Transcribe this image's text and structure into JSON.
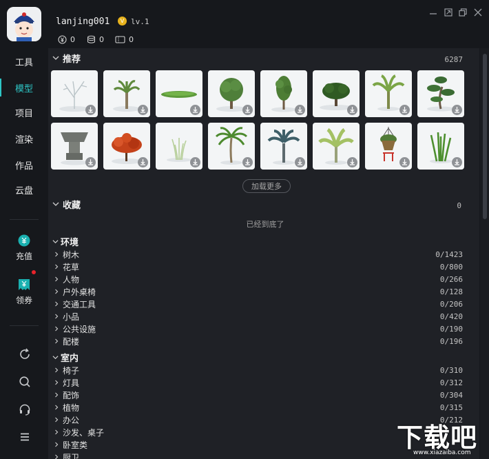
{
  "user": {
    "name": "lanjing001",
    "level": "lv.1",
    "level_badge": "V"
  },
  "stats": [
    {
      "icon": "yen-coin-icon",
      "value": "0"
    },
    {
      "icon": "coin-stack-icon",
      "value": "0"
    },
    {
      "icon": "ticket-icon",
      "value": "0"
    }
  ],
  "window_controls": [
    "minimize-icon",
    "restore-icon",
    "maximize-icon",
    "close-icon"
  ],
  "sidebar": {
    "items": [
      {
        "label": "工具"
      },
      {
        "label": "模型",
        "active": true
      },
      {
        "label": "项目"
      },
      {
        "label": "渲染"
      },
      {
        "label": "作品"
      },
      {
        "label": "云盘"
      }
    ],
    "recharge": {
      "label": "充值",
      "icon": "yen-bubble-icon"
    },
    "coupon": {
      "label": "领券",
      "icon": "coupon-icon"
    },
    "tools": [
      "refresh-icon",
      "search-icon",
      "headset-icon",
      "menu-icon"
    ]
  },
  "recommend": {
    "title": "推荐",
    "count": "6287",
    "load_more": "加载更多",
    "items": [
      {
        "name": "bare-tree"
      },
      {
        "name": "small-palm"
      },
      {
        "name": "grass-patch"
      },
      {
        "name": "round-tree"
      },
      {
        "name": "tall-tree"
      },
      {
        "name": "bushy-tree"
      },
      {
        "name": "banana-plant"
      },
      {
        "name": "bonsai-pine"
      },
      {
        "name": "stone-planter"
      },
      {
        "name": "red-maple"
      },
      {
        "name": "reeds"
      },
      {
        "name": "coconut-palm"
      },
      {
        "name": "fan-palm"
      },
      {
        "name": "banana-tree"
      },
      {
        "name": "hanging-basket"
      },
      {
        "name": "tall-grass"
      }
    ]
  },
  "favorites": {
    "title": "收藏",
    "count": "0",
    "empty_note": "已经到底了"
  },
  "categories": [
    {
      "title": "环境",
      "rows": [
        {
          "label": "树木",
          "count": "0/1423"
        },
        {
          "label": "花草",
          "count": "0/800"
        },
        {
          "label": "人物",
          "count": "0/266"
        },
        {
          "label": "户外桌椅",
          "count": "0/128"
        },
        {
          "label": "交通工具",
          "count": "0/206"
        },
        {
          "label": "小品",
          "count": "0/420"
        },
        {
          "label": "公共设施",
          "count": "0/190"
        },
        {
          "label": "配楼",
          "count": "0/196"
        }
      ]
    },
    {
      "title": "室内",
      "rows": [
        {
          "label": "椅子",
          "count": "0/310"
        },
        {
          "label": "灯具",
          "count": "0/312"
        },
        {
          "label": "配饰",
          "count": "0/304"
        },
        {
          "label": "植物",
          "count": "0/315"
        },
        {
          "label": "办公",
          "count": "0/212"
        },
        {
          "label": "沙发、桌子",
          "count": ""
        },
        {
          "label": "卧室类",
          "count": ""
        },
        {
          "label": "厨卫",
          "count": ""
        }
      ]
    }
  ],
  "watermark": {
    "text": "下载吧",
    "url": "www.xiazaiba.com"
  },
  "colors": {
    "accent": "#2ec5c5",
    "background": "#16181c",
    "panel": "#1f2126",
    "alert": "#e8232b",
    "level_badge": "#e7b21d"
  }
}
